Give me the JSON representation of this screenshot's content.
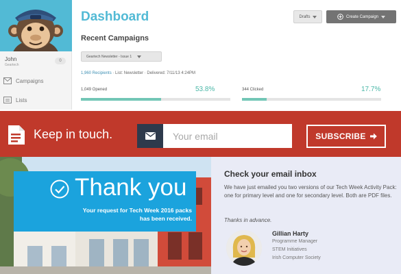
{
  "dashboard": {
    "title": "Dashboard",
    "drafts_label": "Drafts",
    "create_label": "Create Campaign",
    "recent_title": "Recent Campaigns",
    "selected_campaign": "Geartech Newsletter - Issue 1",
    "recipients": "1,960 Recipients",
    "list_label": "List:",
    "list_value": "Newsletter",
    "delivered_label": "Delivered:",
    "delivered_value": "7/11/13 4:24PM",
    "opened_label": "1,049 Opened",
    "opened_pct": "53.8%",
    "opened_fraction": 0.538,
    "clicked_label": "344 Clicked",
    "clicked_pct": "17.7%",
    "clicked_fraction": 0.177
  },
  "sidebar": {
    "user_name": "John",
    "user_org": "Geartech",
    "count": "0",
    "items": [
      {
        "label": "Campaigns",
        "icon": "envelope-icon"
      },
      {
        "label": "Lists",
        "icon": "list-icon"
      }
    ]
  },
  "subscribe": {
    "tagline": "Keep in touch.",
    "email_placeholder": "Your email",
    "button_label": "SUBSCRIBE",
    "colors": {
      "band": "#c0392b",
      "email_icon_bg": "#2e3a4c"
    }
  },
  "thankyou": {
    "heading": "Thank you",
    "message": "Your request for Tech Week 2016 packs has been received.",
    "color": "#1ba3dd"
  },
  "inbox": {
    "title": "Check your email inbox",
    "body": "We have just emailed you two versions of our Tech Week Activity Pack: one for primary level and one for secondary level. Both are PDF files.",
    "thanks": "Thanks in advance.",
    "person": {
      "name": "Gillian Harty",
      "role": "Programme Manager",
      "dept": "STEM Initiatives",
      "org": "Irish Computer Society"
    }
  }
}
